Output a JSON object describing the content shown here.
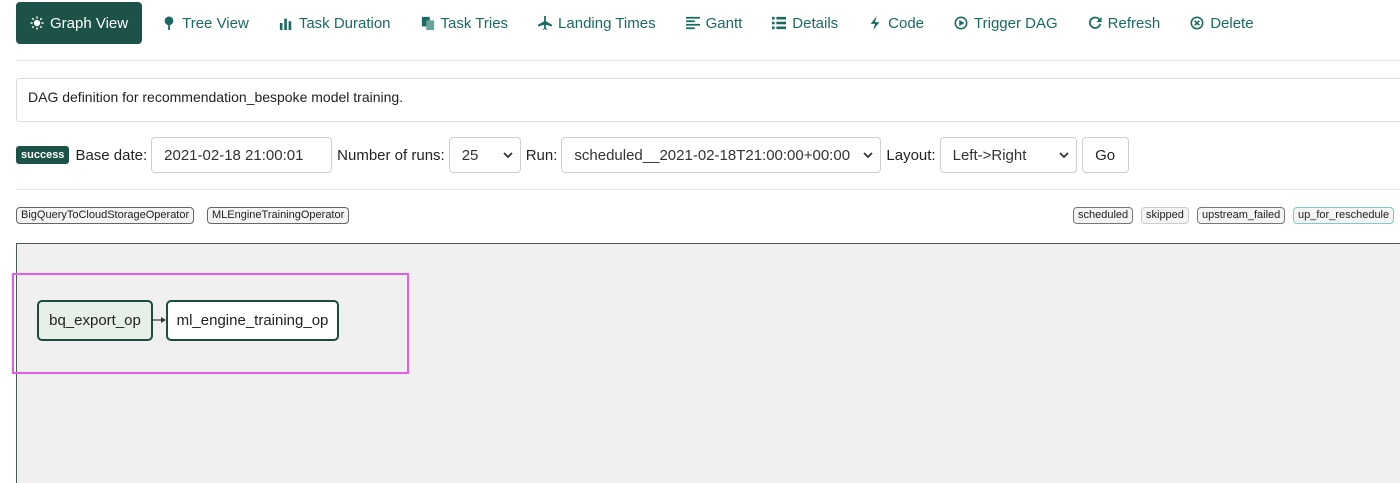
{
  "nav": {
    "tabs": [
      {
        "label": "Graph View",
        "icon": "sun-icon",
        "active": true
      },
      {
        "label": "Tree View",
        "icon": "tree-icon"
      },
      {
        "label": "Task Duration",
        "icon": "bar-chart-icon"
      },
      {
        "label": "Task Tries",
        "icon": "copy-icon"
      },
      {
        "label": "Landing Times",
        "icon": "plane-icon"
      },
      {
        "label": "Gantt",
        "icon": "align-left-icon"
      },
      {
        "label": "Details",
        "icon": "list-icon"
      },
      {
        "label": "Code",
        "icon": "flash-icon"
      },
      {
        "label": "Trigger DAG",
        "icon": "play-circle-icon"
      },
      {
        "label": "Refresh",
        "icon": "refresh-icon"
      },
      {
        "label": "Delete",
        "icon": "remove-circle-icon"
      }
    ]
  },
  "description": "DAG definition for recommendation_bespoke model training.",
  "controls": {
    "status_badge": "success",
    "base_date_label": "Base date:",
    "base_date_value": "2021-02-18 21:00:01",
    "num_runs_label": "Number of runs:",
    "num_runs_value": "25",
    "run_label": "Run:",
    "run_value": "scheduled__2021-02-18T21:00:00+00:00",
    "layout_label": "Layout:",
    "layout_value": "Left->Right",
    "go_label": "Go"
  },
  "operators": [
    "BigQueryToCloudStorageOperator",
    "MLEngineTrainingOperator"
  ],
  "states": [
    "scheduled",
    "skipped",
    "upstream_failed",
    "up_for_reschedule"
  ],
  "graph": {
    "nodes": [
      "bq_export_op",
      "ml_engine_training_op"
    ],
    "edges": [
      [
        "bq_export_op",
        "ml_engine_training_op"
      ]
    ]
  },
  "colors": {
    "primary": "#1d5249",
    "link": "#1a6a62",
    "highlight": "#e45de8",
    "graph_bg": "#f0f0f0"
  }
}
